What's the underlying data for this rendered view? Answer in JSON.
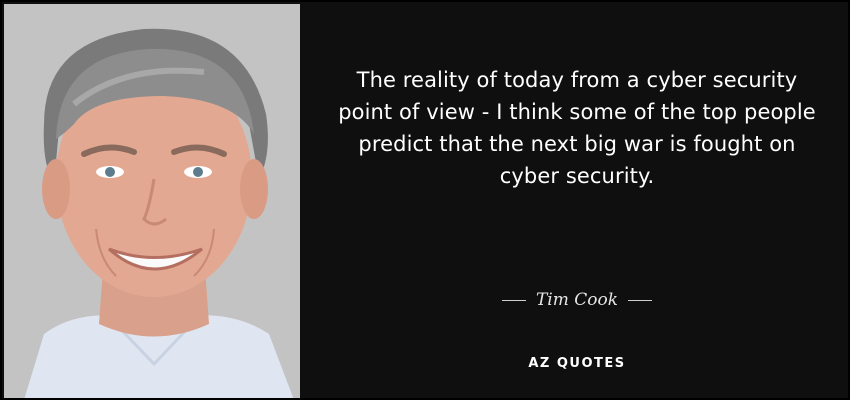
{
  "quote": {
    "text": "The reality of today from a cyber security point of view - I think some of the top people predict that the next big war is fought on cyber security."
  },
  "author": {
    "name": "Tim Cook"
  },
  "brand": {
    "logo_text": "AZ QUOTES"
  },
  "colors": {
    "background": "#0f0f0f",
    "text": "#ffffff"
  },
  "portrait": {
    "description_icon": "portrait-photo"
  }
}
